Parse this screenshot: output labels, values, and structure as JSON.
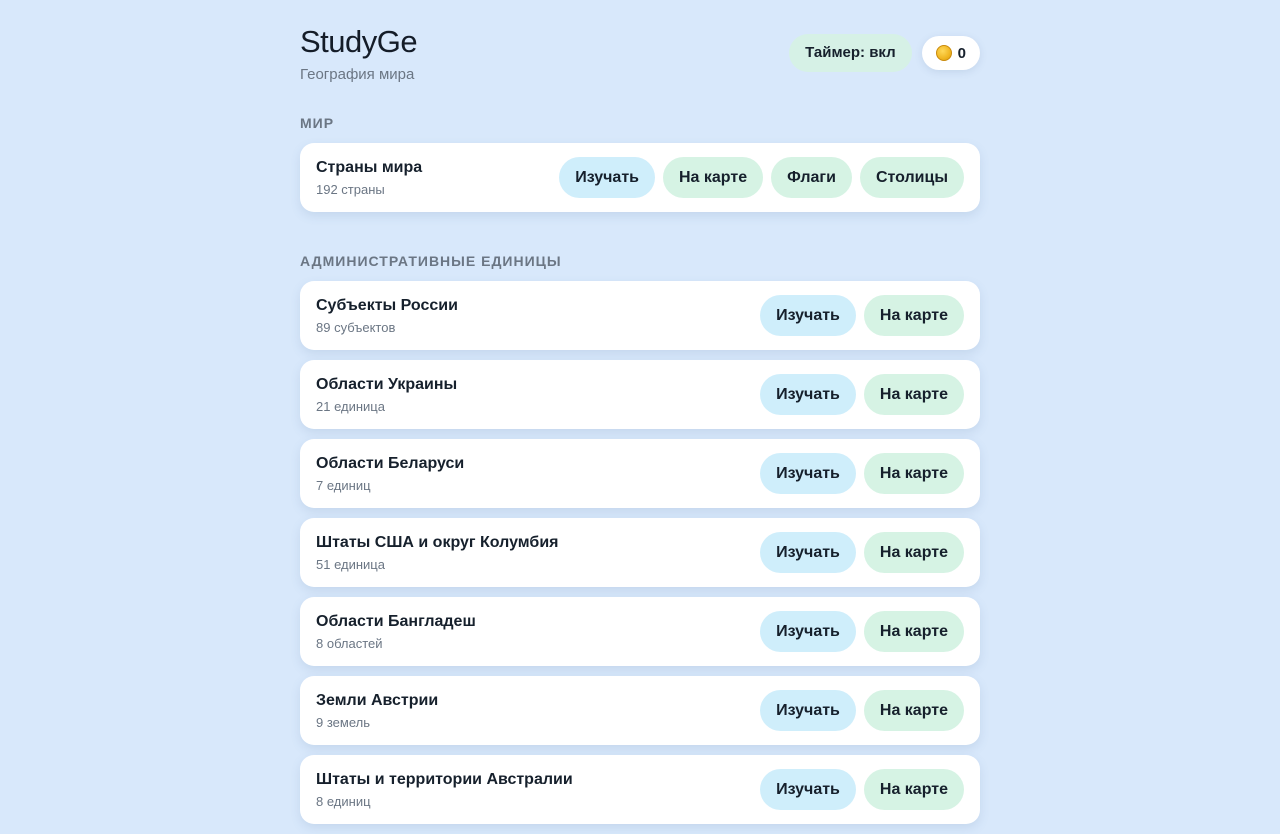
{
  "header": {
    "title": "StudyGe",
    "subtitle": "География мира",
    "timer_label": "Таймер: вкл",
    "coin_count": "0",
    "coin_icon": "coin-icon"
  },
  "sections": {
    "world": {
      "title": "МИР",
      "items": [
        {
          "title": "Страны мира",
          "subtitle": "192 страны",
          "actions": [
            "Изучать",
            "На карте",
            "Флаги",
            "Столицы"
          ]
        }
      ]
    },
    "admin": {
      "title": "АДМИНИСТРАТИВНЫЕ ЕДИНИЦЫ",
      "items": [
        {
          "title": "Субъекты России",
          "subtitle": "89 субъектов",
          "actions": [
            "Изучать",
            "На карте"
          ]
        },
        {
          "title": "Области Украины",
          "subtitle": "21 единица",
          "actions": [
            "Изучать",
            "На карте"
          ]
        },
        {
          "title": "Области Беларуси",
          "subtitle": "7 единиц",
          "actions": [
            "Изучать",
            "На карте"
          ]
        },
        {
          "title": "Штаты США и округ Колумбия",
          "subtitle": "51 единица",
          "actions": [
            "Изучать",
            "На карте"
          ]
        },
        {
          "title": "Области Бангладеш",
          "subtitle": "8 областей",
          "actions": [
            "Изучать",
            "На карте"
          ]
        },
        {
          "title": "Земли Австрии",
          "subtitle": "9 земель",
          "actions": [
            "Изучать",
            "На карте"
          ]
        },
        {
          "title": "Штаты и территории Австралии",
          "subtitle": "8 единиц",
          "actions": [
            "Изучать",
            "На карте"
          ]
        }
      ]
    }
  },
  "colors": {
    "background": "#d8e8fb",
    "study_button": "#cfeefb",
    "map_button": "#d6f3e4"
  }
}
